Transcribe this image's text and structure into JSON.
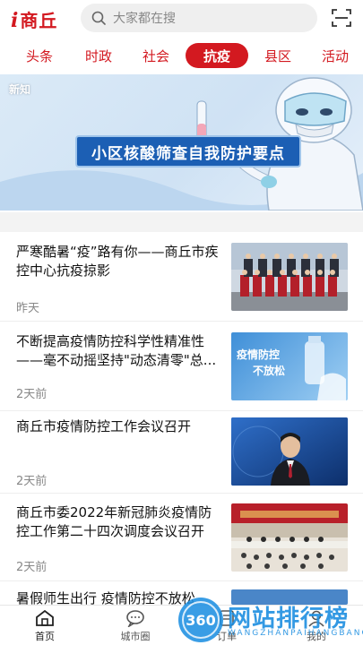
{
  "header": {
    "logo_i": "i",
    "logo_name": "商丘",
    "search_placeholder": "大家都在搜"
  },
  "tabs": [
    {
      "label": "头条",
      "active": false
    },
    {
      "label": "时政",
      "active": false
    },
    {
      "label": "社会",
      "active": false
    },
    {
      "label": "抗疫",
      "active": true
    },
    {
      "label": "县区",
      "active": false
    },
    {
      "label": "活动",
      "active": false
    }
  ],
  "banner": {
    "title": "小区核酸筛查自我防护要点",
    "logo": "新知"
  },
  "news": [
    {
      "title": "严寒酷暑“疫”路有你——商丘市疾控中心抗疫掠影",
      "time": "昨天",
      "thumb": "group-photo"
    },
    {
      "title": "不断提高疫情防控科学性精准性——毫不动摇坚持\"动态清零\"总...",
      "time": "2天前",
      "thumb": "poster",
      "thumb_text": [
        "疫情防控",
        "不放松"
      ]
    },
    {
      "title": "商丘市疫情防控工作会议召开",
      "time": "2天前",
      "thumb": "news-anchor"
    },
    {
      "title": "商丘市委2022年新冠肺炎疫情防控工作第二十四次调度会议召开",
      "time": "2天前",
      "thumb": "meeting-hall"
    },
    {
      "title": "暑假师生出行 疫情防控不放松",
      "time": "",
      "thumb": "partial"
    }
  ],
  "bottom_nav": [
    {
      "label": "首页",
      "icon": "home-icon"
    },
    {
      "label": "城市圈",
      "icon": "chat-icon"
    },
    {
      "label": "",
      "icon": "center-icon"
    },
    {
      "label": "订单",
      "icon": "order-icon"
    },
    {
      "label": "我的",
      "icon": "user-icon"
    }
  ],
  "watermark": {
    "badge": "360",
    "text": "网站排行榜",
    "sub": "WANGZHANPAIHANGBANG"
  },
  "colors": {
    "brand": "#d31920",
    "watermark": "#1e8fe1"
  }
}
